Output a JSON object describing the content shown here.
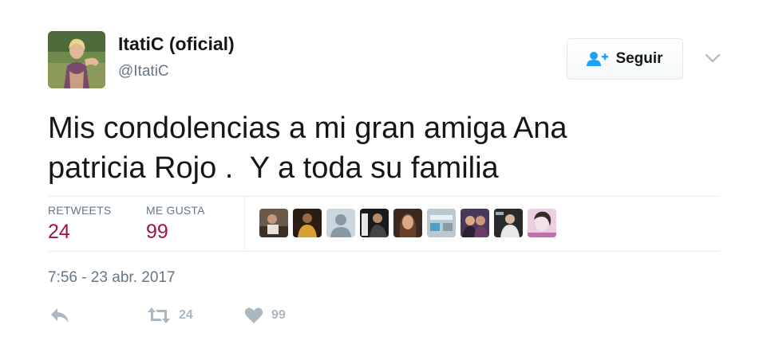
{
  "author": {
    "name": "ItatiC (oficial)",
    "handle": "@ItatiC",
    "avatar_icon": "profile-photo"
  },
  "follow_button": {
    "label": "Seguir",
    "icon": "add-user-icon",
    "accent": "#1da1f2"
  },
  "tweet": {
    "text": "Mis condolencias a mi gran amiga Ana\npatricia Rojo .  Y a toda su familia"
  },
  "stats": {
    "retweets_label": "RETWEETS",
    "retweets_count": "24",
    "likes_label": "ME GUSTA",
    "likes_count": "99",
    "count_color": "#a5124a"
  },
  "liked_by": [
    {
      "icon": "user-avatar-photo"
    },
    {
      "icon": "user-avatar-photo"
    },
    {
      "icon": "default-avatar-silhouette"
    },
    {
      "icon": "user-avatar-photo"
    },
    {
      "icon": "user-avatar-photo"
    },
    {
      "icon": "user-avatar-photo"
    },
    {
      "icon": "user-avatar-photo"
    },
    {
      "icon": "user-avatar-photo"
    },
    {
      "icon": "user-avatar-photo"
    }
  ],
  "timestamp": "7:56 - 23 abr. 2017",
  "actions": {
    "reply_icon": "reply-icon",
    "retweet_icon": "retweet-icon",
    "retweet_count": "24",
    "like_icon": "heart-icon",
    "like_count": "99",
    "icon_color": "#aab8c2"
  }
}
